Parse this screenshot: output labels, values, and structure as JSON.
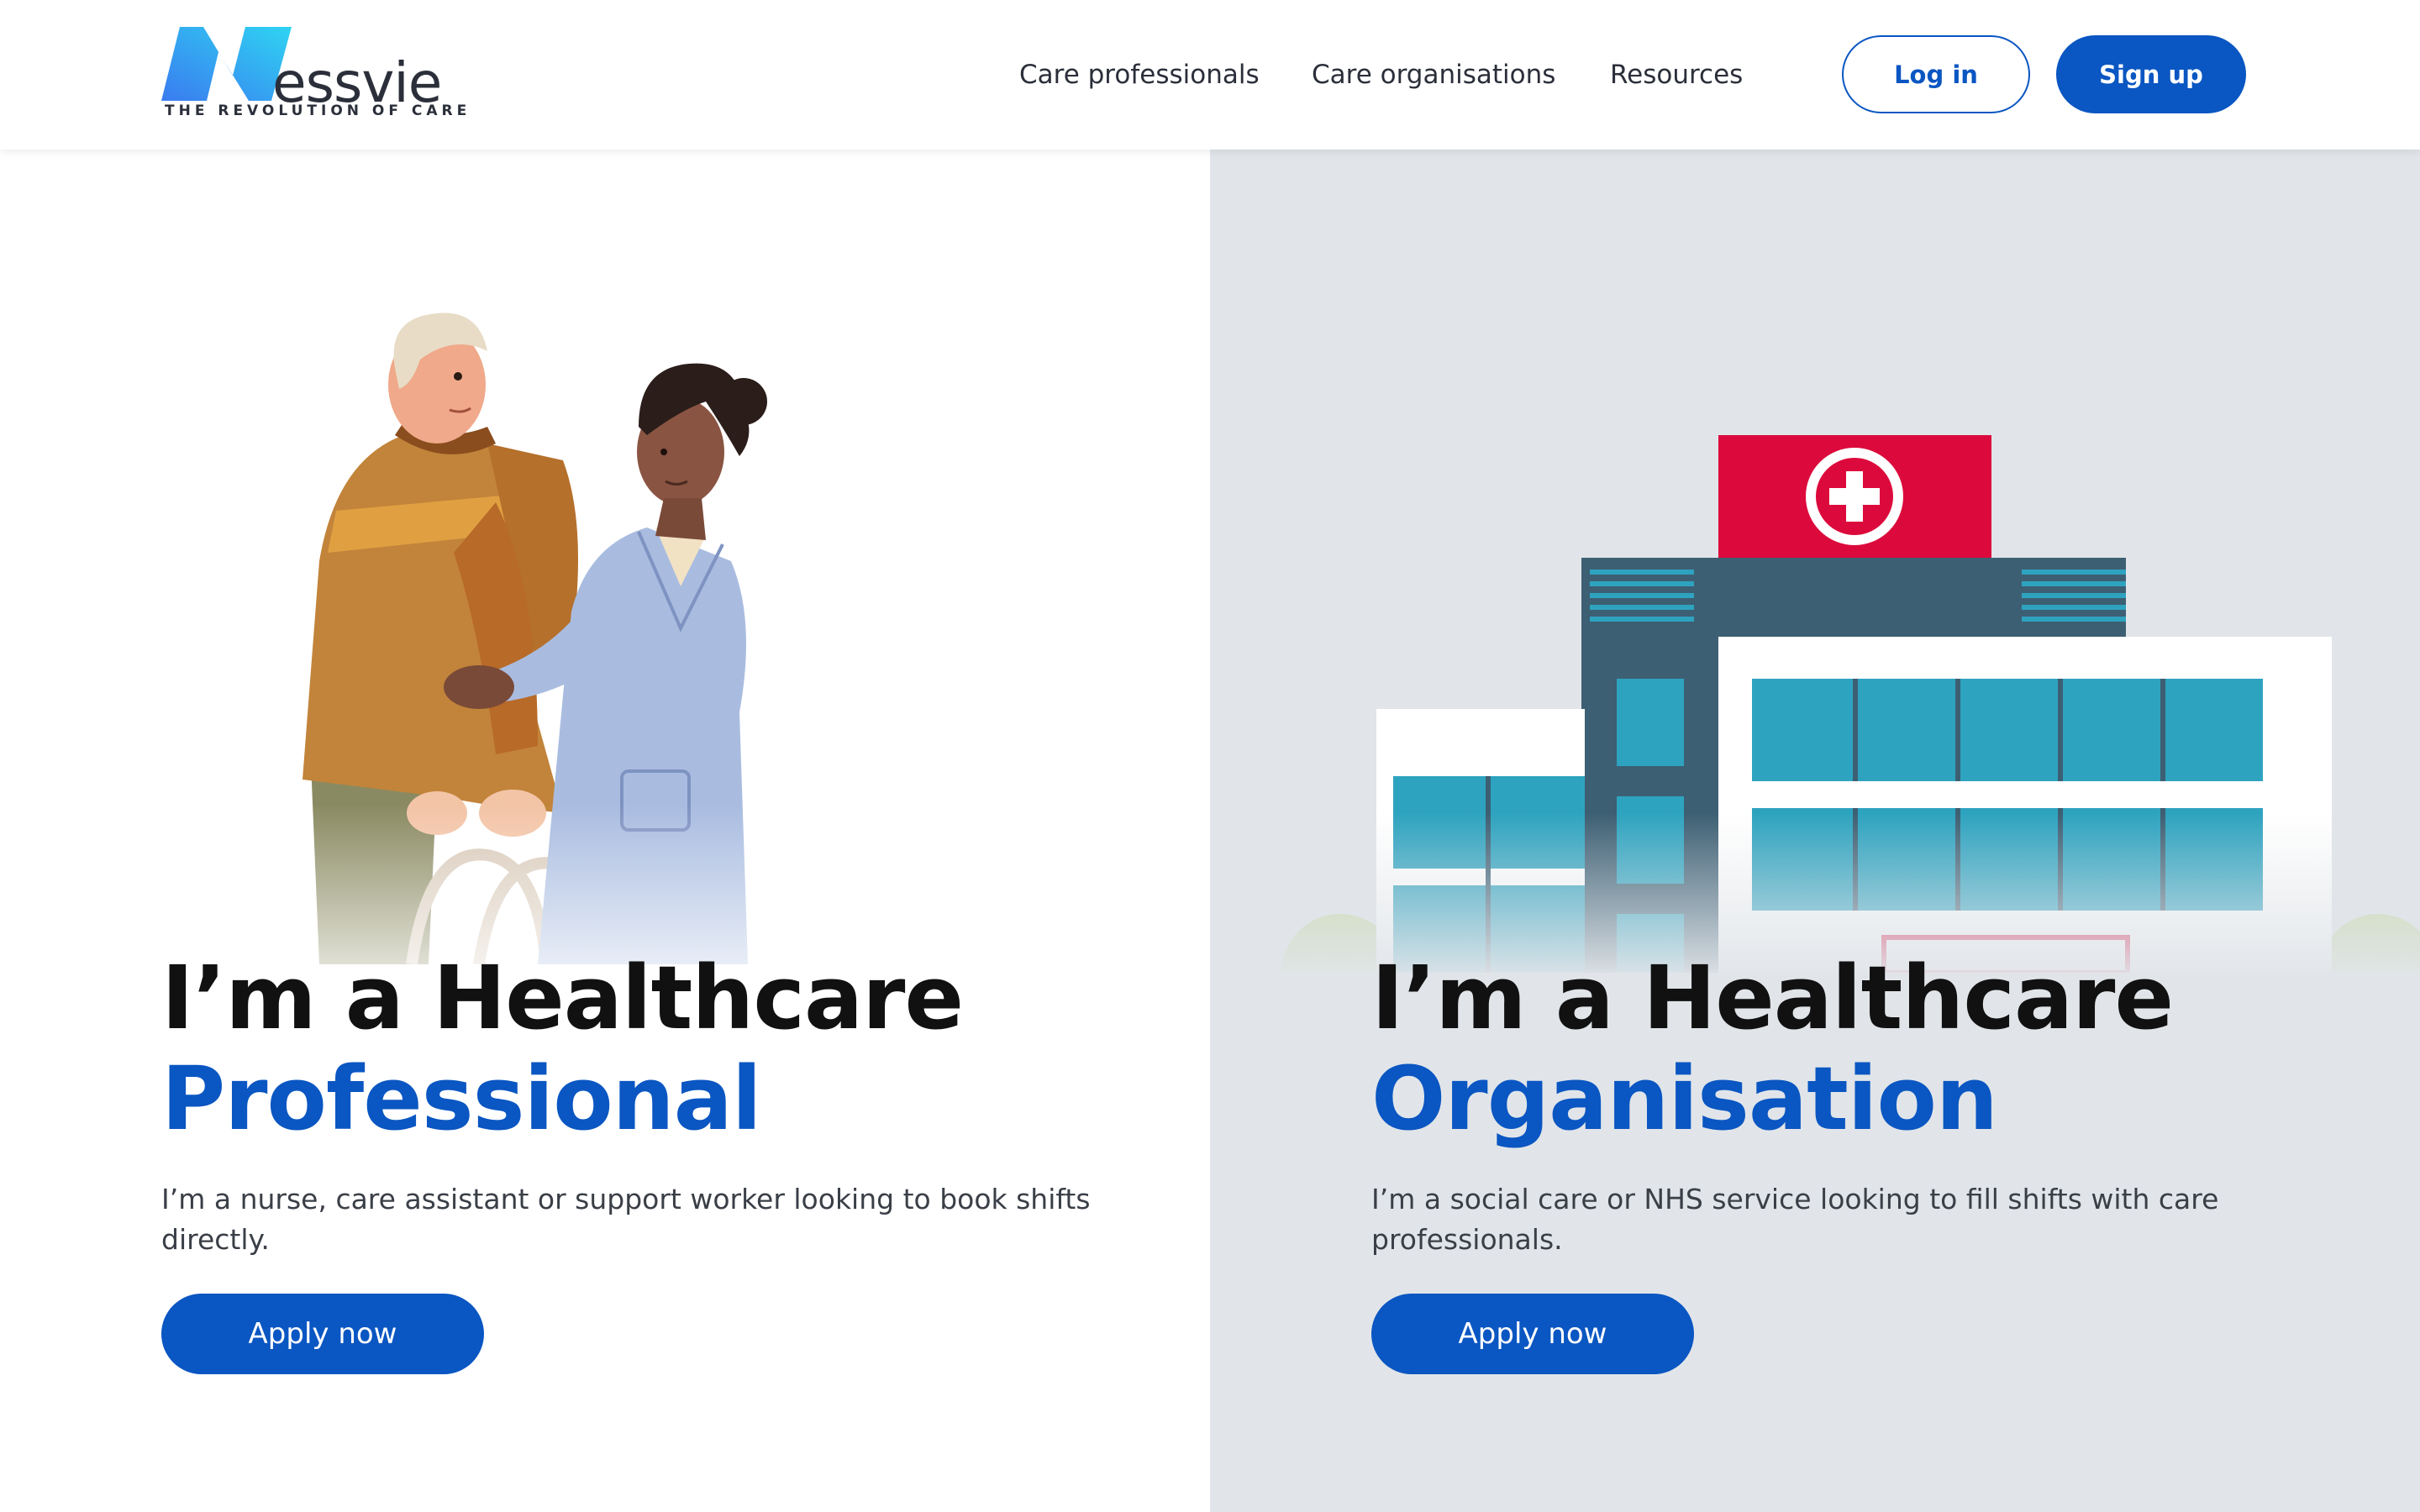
{
  "brand": {
    "name": "essvie",
    "tagline": "THE REVOLUTION OF CARE"
  },
  "nav": {
    "items": [
      {
        "label": "Care professionals"
      },
      {
        "label": "Care organisations"
      },
      {
        "label": "Resources"
      }
    ],
    "login_label": "Log in",
    "signup_label": "Sign up"
  },
  "professional": {
    "heading_line1": "I’m a Healthcare",
    "heading_line2": "Professional",
    "description": "I’m a nurse, care assistant or support worker looking to book shifts directly.",
    "cta_label": "Apply now"
  },
  "organisation": {
    "heading_line1": "I’m a Healthcare",
    "heading_line2": "Organisation",
    "description": "I’m a social care or NHS service looking to fill shifts with care professionals.",
    "cta_label": "Apply now"
  },
  "colors": {
    "accent": "#0a56c2",
    "right_panel_bg": "#e1e5e9",
    "hospital_sign": "#dc0a3c",
    "hospital_dark": "#3d5f73",
    "glass": "#2ea3bf"
  }
}
